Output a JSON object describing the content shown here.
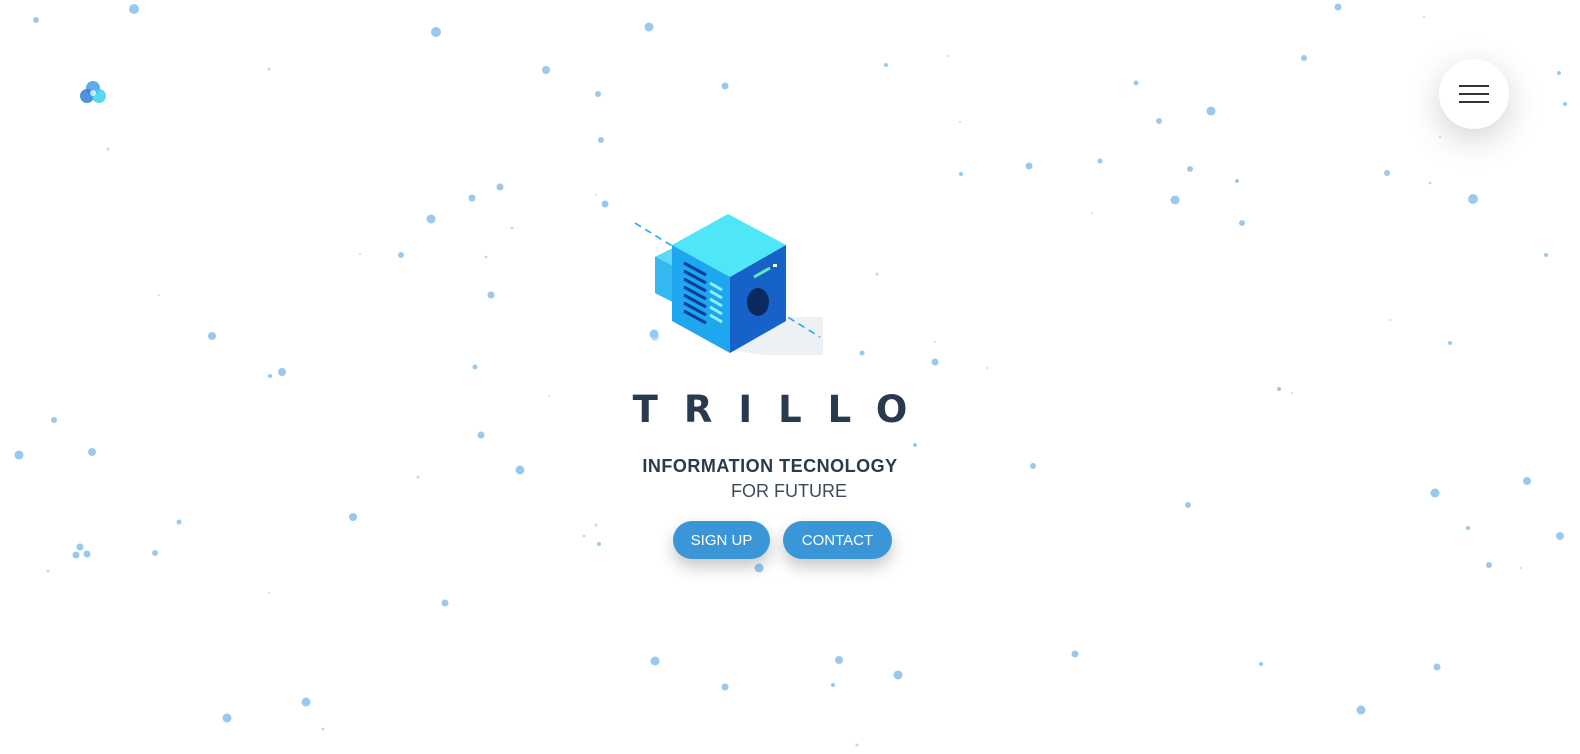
{
  "header": {
    "logo_icon": "trillo-logo-icon",
    "menu_icon": "hamburger-menu-icon"
  },
  "hero": {
    "illustration_icon": "server-cube-illustration",
    "title": "TRILLO",
    "subtitle": "INFORMATION TECNOLOGY",
    "tagline": "FOR FUTURE",
    "buttons": {
      "signup_label": "SIGN UP",
      "contact_label": "CONTACT"
    }
  },
  "colors": {
    "accent": "#3b96d8",
    "text_dark": "#2a3a4e",
    "particle": "#8fc3ec",
    "background": "#ffffff"
  }
}
